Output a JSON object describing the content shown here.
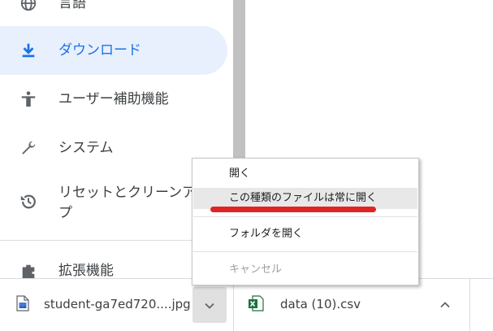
{
  "sidebar": {
    "items": [
      {
        "label": "言語",
        "icon": "globe-icon"
      },
      {
        "label": "ダウンロード",
        "icon": "download-icon"
      },
      {
        "label": "ユーザー補助機能",
        "icon": "accessibility-icon"
      },
      {
        "label": "システム",
        "icon": "wrench-icon"
      },
      {
        "label": "リセットとクリーンアップ",
        "label_line1": "リセットとクリーンア",
        "label_line2": "プ",
        "icon": "history-icon"
      },
      {
        "label": "拡張機能",
        "icon": "extension-icon"
      }
    ],
    "active_index": 1
  },
  "context_menu": {
    "items": [
      {
        "label": "開く"
      },
      {
        "label": "この種類のファイルは常に開く",
        "highlighted": true
      },
      {
        "label": "フォルダを開く"
      },
      {
        "label": "キャンセル",
        "disabled": true
      }
    ]
  },
  "download_bar": {
    "items": [
      {
        "filename": "student-ga7ed720....jpg",
        "icon": "image-file-icon"
      },
      {
        "filename": "data (10).csv",
        "icon": "excel-file-icon"
      }
    ]
  },
  "colors": {
    "accent": "#1a73e8",
    "active_bg": "#e8f0fe",
    "highlight_underline": "#e02424"
  }
}
